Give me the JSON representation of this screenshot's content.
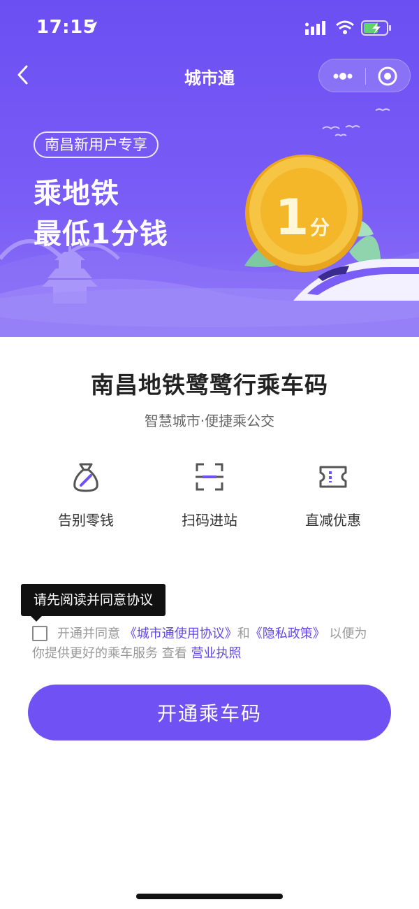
{
  "status_bar": {
    "time": "17:15"
  },
  "navbar": {
    "title": "城市通"
  },
  "hero": {
    "tag": "南昌新用户专享",
    "headline_line1": "乘地铁",
    "headline_line2": "最低1分钱",
    "coin_value": "1",
    "coin_unit": "分"
  },
  "main": {
    "title": "南昌地铁鹭鹭行乘车码",
    "subtitle": "智慧城市·便捷乘公交"
  },
  "features": [
    {
      "icon": "money-bag-icon",
      "label": "告别零钱"
    },
    {
      "icon": "scan-icon",
      "label": "扫码进站"
    },
    {
      "icon": "ticket-icon",
      "label": "直减优惠"
    }
  ],
  "tooltip": {
    "text": "请先阅读并同意协议"
  },
  "agreement": {
    "prefix": "开通并同意",
    "terms_link": "《城市通使用协议》",
    "and": "和",
    "privacy_link": "《隐私政策》",
    "suffix": "以便为",
    "line2_text": "你提供更好的乘车服务 查看",
    "license_link": "营业执照"
  },
  "cta": {
    "label": "开通乘车码"
  },
  "colors": {
    "primary": "#7052f4",
    "link": "#6347e8",
    "hero_bg": "#6b4ff2",
    "coin": "#f5b72a"
  }
}
